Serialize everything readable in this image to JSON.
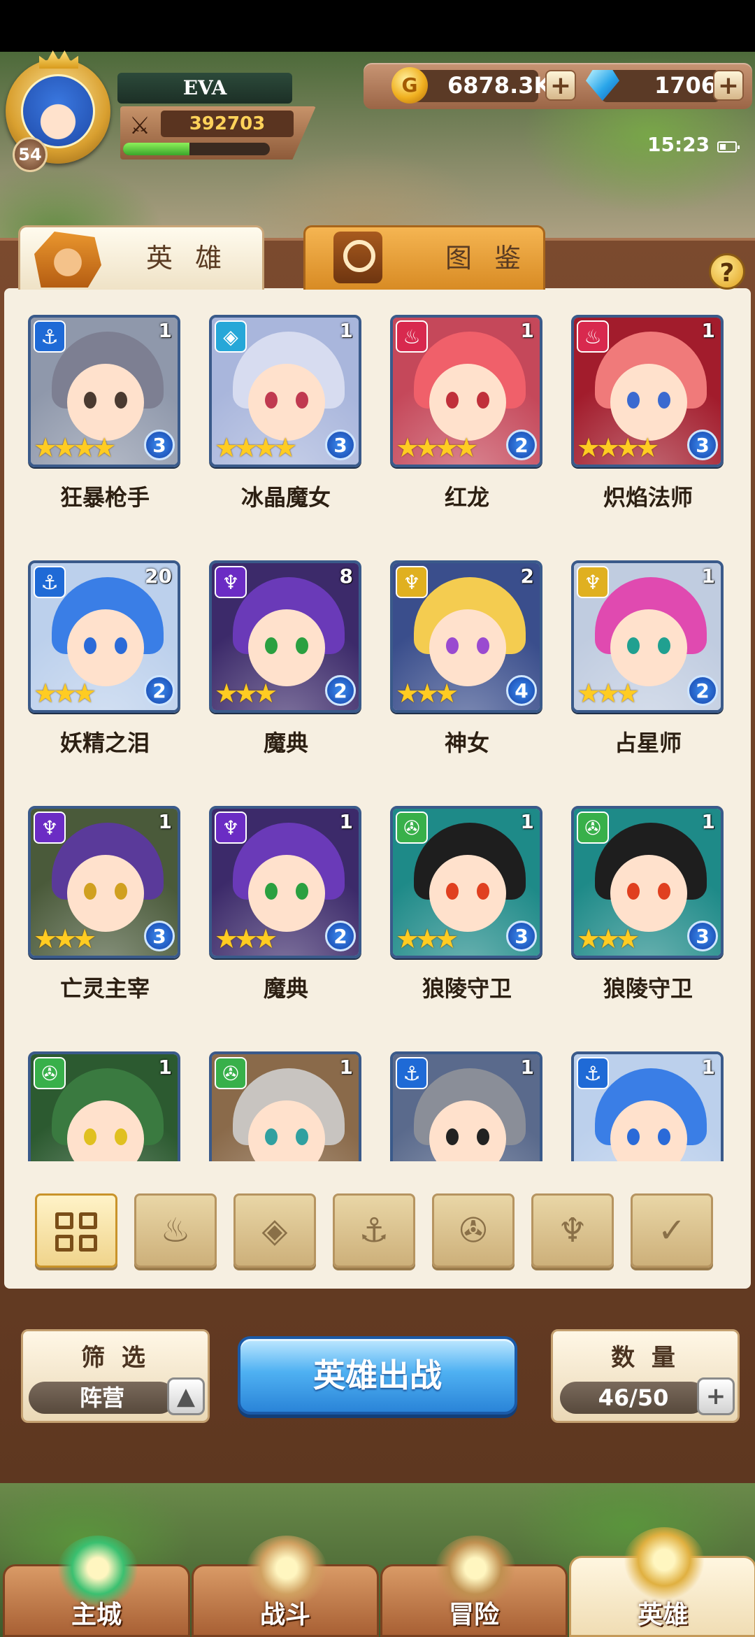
{
  "player": {
    "name": "EVA",
    "level": "54",
    "power": "392703",
    "xp_fraction": 0.45
  },
  "currency": {
    "gold": "6878.3K",
    "gems": "1706",
    "plus": "+"
  },
  "status": {
    "time": "15:23"
  },
  "tabs": {
    "heroes": "英 雄",
    "codex": "图 鉴",
    "help": "?"
  },
  "colors": {
    "faction_water": "#1f6ad6",
    "faction_ice": "#26a7d8",
    "faction_fire": "#d8294e",
    "faction_dark": "#6b2cc4",
    "faction_light": "#e0b020",
    "faction_nature": "#38b04a"
  },
  "heroes": [
    {
      "name": "狂暴枪手",
      "count": "1",
      "stars": "★★★★",
      "grade": "3",
      "faction": "⚓",
      "faction_color": "#1f6ad6",
      "hair": "#7d7f92",
      "eye": "#4a3a30",
      "bg": "#8f98ab"
    },
    {
      "name": "冰晶魔女",
      "count": "1",
      "stars": "★★★★",
      "grade": "3",
      "faction": "◈",
      "faction_color": "#26a7d8",
      "hair": "#d7dcf0",
      "eye": "#c03a50",
      "bg": "#a9b6dc"
    },
    {
      "name": "红龙",
      "count": "1",
      "stars": "★★★★",
      "grade": "2",
      "faction": "♨",
      "faction_color": "#d8294e",
      "hair": "#f0606a",
      "eye": "#c0303a",
      "bg": "#c5485a"
    },
    {
      "name": "炽焰法师",
      "count": "1",
      "stars": "★★★★",
      "grade": "3",
      "faction": "♨",
      "faction_color": "#d8294e",
      "hair": "#f07a7a",
      "eye": "#3a6ad0",
      "bg": "#a21c2c"
    },
    {
      "name": "妖精之泪",
      "count": "20",
      "stars": "★★★",
      "grade": "2",
      "faction": "⚓",
      "faction_color": "#1f6ad6",
      "hair": "#3a7ee6",
      "eye": "#2a6ad8",
      "bg": "#bcd0ec"
    },
    {
      "name": "魔典",
      "count": "8",
      "stars": "★★★",
      "grade": "2",
      "faction": "♆",
      "faction_color": "#6b2cc4",
      "hair": "#6a3ab8",
      "eye": "#2aa040",
      "bg": "#3c2a6a"
    },
    {
      "name": "神女",
      "count": "2",
      "stars": "★★★",
      "grade": "4",
      "faction": "♆",
      "faction_color": "#e0b020",
      "hair": "#f4cc50",
      "eye": "#9a4ad0",
      "bg": "#3a4e8c"
    },
    {
      "name": "占星师",
      "count": "1",
      "stars": "★★★",
      "grade": "2",
      "faction": "♆",
      "faction_color": "#e0b020",
      "hair": "#e04ab0",
      "eye": "#20a090",
      "bg": "#c0cce0"
    },
    {
      "name": "亡灵主宰",
      "count": "1",
      "stars": "★★★",
      "grade": "3",
      "faction": "♆",
      "faction_color": "#6b2cc4",
      "hair": "#5a3a9a",
      "eye": "#d0a020",
      "bg": "#4a5a3a"
    },
    {
      "name": "魔典",
      "count": "1",
      "stars": "★★★",
      "grade": "2",
      "faction": "♆",
      "faction_color": "#6b2cc4",
      "hair": "#6a3ab8",
      "eye": "#2aa040",
      "bg": "#3c2a6a"
    },
    {
      "name": "狼陵守卫",
      "count": "1",
      "stars": "★★★",
      "grade": "3",
      "faction": "✇",
      "faction_color": "#38b04a",
      "hair": "#1e1e1e",
      "eye": "#e04020",
      "bg": "#1e8a88"
    },
    {
      "name": "狼陵守卫",
      "count": "1",
      "stars": "★★★",
      "grade": "3",
      "faction": "✇",
      "faction_color": "#38b04a",
      "hair": "#1e1e1e",
      "eye": "#e04020",
      "bg": "#1e8a88"
    },
    {
      "name": "",
      "count": "1",
      "stars": "",
      "grade": "",
      "faction": "✇",
      "faction_color": "#38b04a",
      "hair": "#3a7a40",
      "eye": "#e0c020",
      "bg": "#2c5a30"
    },
    {
      "name": "",
      "count": "1",
      "stars": "",
      "grade": "",
      "faction": "✇",
      "faction_color": "#38b04a",
      "hair": "#c8c4c0",
      "eye": "#30a0a0",
      "bg": "#8a6a4a"
    },
    {
      "name": "",
      "count": "1",
      "stars": "",
      "grade": "",
      "faction": "⚓",
      "faction_color": "#1f6ad6",
      "hair": "#8a8e98",
      "eye": "#222222",
      "bg": "#5a6a8c"
    },
    {
      "name": "",
      "count": "1",
      "stars": "",
      "grade": "",
      "faction": "⚓",
      "faction_color": "#1f6ad6",
      "hair": "#3a7ee6",
      "eye": "#2a6ad8",
      "bg": "#bcd0ec"
    }
  ],
  "filters": [
    {
      "icon": "all-grid-icon",
      "glyph": ""
    },
    {
      "icon": "fire-faction-icon",
      "glyph": "♨"
    },
    {
      "icon": "ice-faction-icon",
      "glyph": "◈"
    },
    {
      "icon": "water-faction-icon",
      "glyph": "⚓"
    },
    {
      "icon": "nature-faction-icon",
      "glyph": "✇"
    },
    {
      "icon": "dark-faction-icon",
      "glyph": "♆"
    },
    {
      "icon": "light-faction-icon",
      "glyph": "✓"
    }
  ],
  "controls": {
    "filter_title": "筛 选",
    "filter_value": "阵营",
    "filter_toggle": "▲",
    "deploy": "英雄出战",
    "count_title": "数 量",
    "count_value": "46/50",
    "count_plus": "+"
  },
  "nav": [
    {
      "label": "主城",
      "icon": "castle-icon",
      "color": "#3ac070"
    },
    {
      "label": "战斗",
      "icon": "crossed-swords-icon",
      "color": "#d0a060"
    },
    {
      "label": "冒险",
      "icon": "map-scroll-icon",
      "color": "#c09050"
    },
    {
      "label": "英雄",
      "icon": "hero-helmet-icon",
      "color": "#e0b040"
    }
  ]
}
